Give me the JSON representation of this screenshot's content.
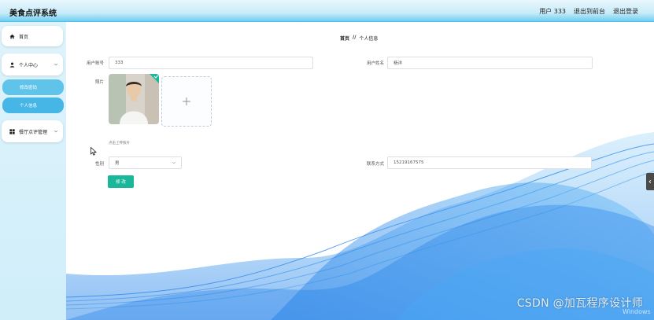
{
  "header": {
    "title": "美食点评系统",
    "user_label": "用户 333",
    "back_to_front": "退出到前台",
    "logout": "退出登录"
  },
  "sidebar": {
    "items": [
      {
        "label": "首页",
        "icon": "home-icon"
      },
      {
        "label": "个人中心",
        "icon": "user-icon"
      },
      {
        "label": "修改密码",
        "icon": ""
      },
      {
        "label": "个人信息",
        "icon": ""
      },
      {
        "label": "餐厅点评管理",
        "icon": "grid-icon"
      }
    ]
  },
  "breadcrumb": {
    "home": "首页",
    "separator": "//",
    "current": "个人信息"
  },
  "form": {
    "account_label": "用户账号",
    "account_value": "333",
    "name_label": "用户姓名",
    "name_value": "杨洋",
    "photo_label": "照片",
    "upload_hint": "点击上传照片",
    "gender_label": "性别",
    "gender_value": "男",
    "contact_label": "联系方式",
    "contact_value": "15219167575",
    "submit_label": "修 改"
  },
  "overlay": {
    "csdn_watermark": "CSDN @加瓦程序设计师",
    "windows_text": "Windows"
  },
  "colors": {
    "accent": "#45b6e6",
    "submit": "#19b89a",
    "header_bottom": "#6fcdf0"
  }
}
